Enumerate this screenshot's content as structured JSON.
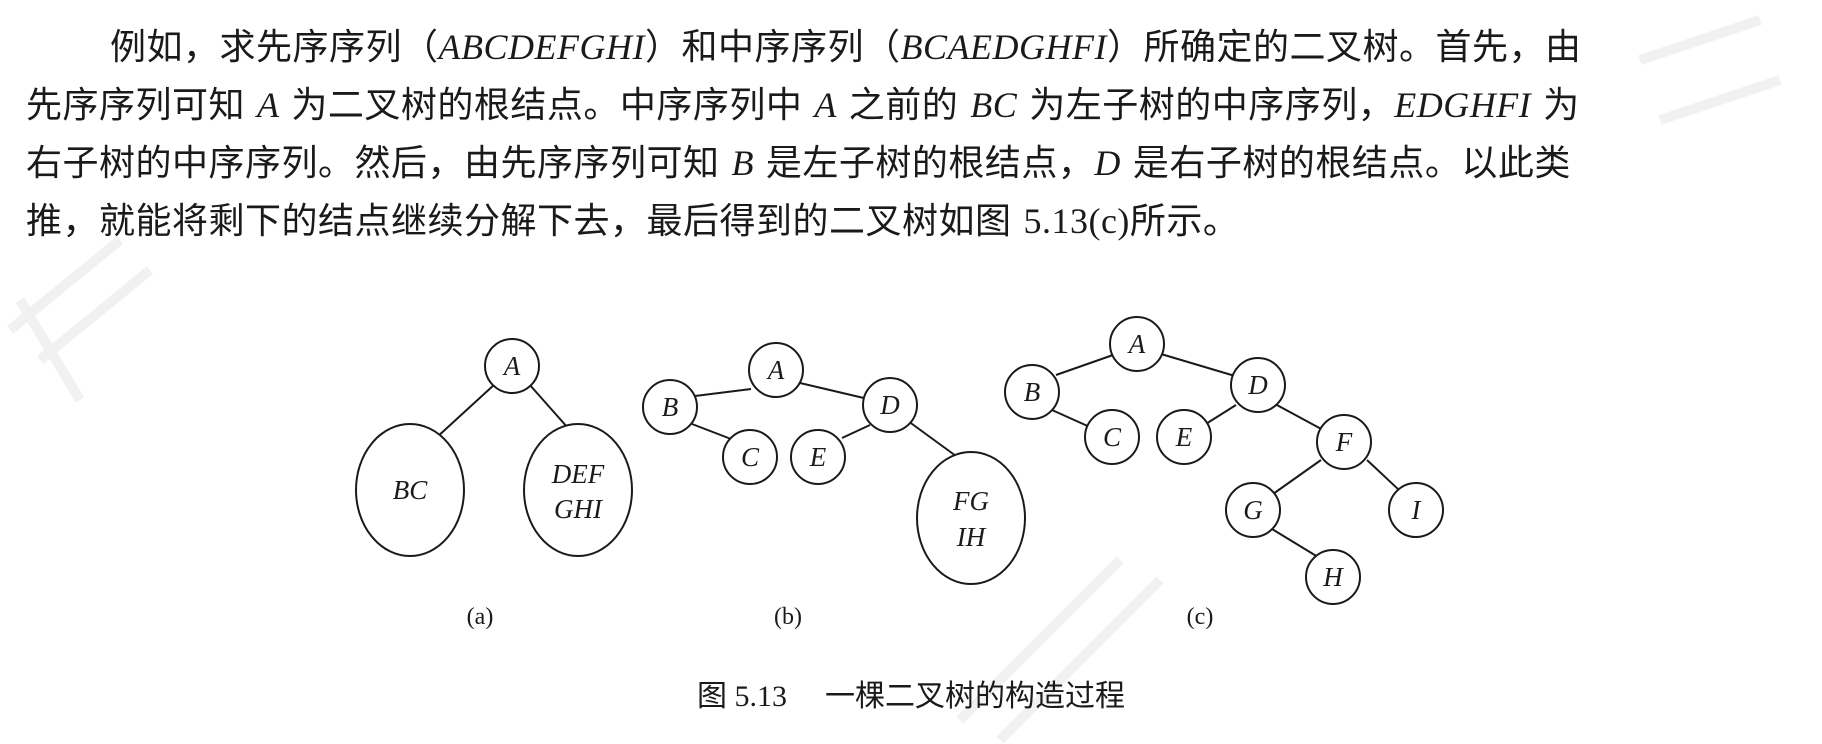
{
  "paragraph": {
    "line1": {
      "a": "例如，求先序序列（",
      "b": "ABCDEFGHI",
      "c": "）和中序序列（",
      "d": "BCAEDGHFI",
      "e": "）所确定的二叉树。首先，由"
    },
    "line2": {
      "a": "先序序列可知 ",
      "b": "A",
      "c": " 为二叉树的根结点。中序序列中 ",
      "d": "A",
      "e": " 之前的 ",
      "f": "BC",
      "g": " 为左子树的中序序列，",
      "h": "EDGHFI",
      "i": " 为"
    },
    "line3": {
      "a": "右子树的中序序列。然后，由先序序列可知 ",
      "b": "B",
      "c": " 是左子树的根结点，",
      "d": "D",
      "e": " 是右子树的根结点。以此类"
    },
    "line4": {
      "a": "推，就能将剩下的结点继续分解下去，最后得到的二叉树如图 ",
      "b": "5.13(c)",
      "c": "所示。"
    }
  },
  "figure": {
    "a": {
      "root": "A",
      "left_line1": "BC",
      "right_line1": "DEF",
      "right_line2": "GHI",
      "label": "(a)"
    },
    "b": {
      "root": "A",
      "n_b": "B",
      "n_c": "C",
      "n_d": "D",
      "n_e": "E",
      "sub_line1": "FG",
      "sub_line2": "IH",
      "label": "(b)"
    },
    "c": {
      "root": "A",
      "n_b": "B",
      "n_c": "C",
      "n_d": "D",
      "n_e": "E",
      "n_f": "F",
      "n_g": "G",
      "n_i": "I",
      "n_h": "H",
      "label": "(c)"
    }
  },
  "caption": {
    "number": "图 5.13",
    "title": "一棵二叉树的构造过程"
  },
  "colors": {
    "ink": "#1a1a1a",
    "watermark": "#c8c8c8"
  }
}
